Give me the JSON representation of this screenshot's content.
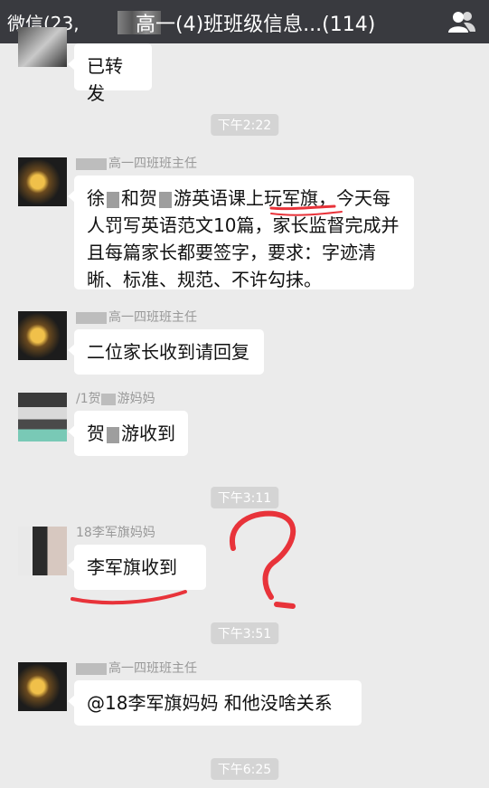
{
  "header": {
    "back_label": "微信(23,",
    "chat_title": "高一(4)班班级信息...(114)"
  },
  "messages": [
    {
      "text": "已转发"
    },
    {
      "time": "下午2:22"
    },
    {
      "sender": "高一四班班主任",
      "text_parts": [
        "徐",
        "和贺",
        "游英语课上玩军旗，今天每人罚写英语范文10篇，家长监督完成并且每篇家长都要签字，要求：字迹清晰、标准、规范、不许勾抹。"
      ]
    },
    {
      "sender": "高一四班班主任",
      "text": "二位家长收到请回复"
    },
    {
      "sender_parts": [
        "/1贺",
        "游妈妈"
      ],
      "text_parts": [
        "贺",
        "游收到"
      ]
    },
    {
      "time": "下午3:11"
    },
    {
      "sender": "18李军旗妈妈",
      "text": "李军旗收到"
    },
    {
      "time": "下午3:51"
    },
    {
      "sender": "高一四班班主任",
      "text": "@18李军旗妈妈 和他没啥关系"
    },
    {
      "time": "下午6:25"
    }
  ],
  "colors": {
    "topbar": "#393a3f",
    "background": "#ebebeb",
    "annotation": "#e8333a"
  },
  "icons": {
    "back": "chevron-left-icon",
    "contacts": "contacts-icon"
  }
}
